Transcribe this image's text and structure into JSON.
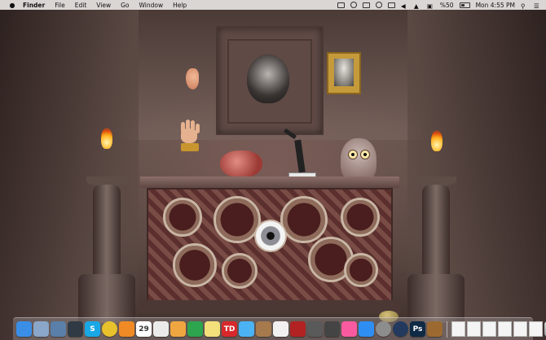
{
  "menubar": {
    "app_name": "Finder",
    "menus": [
      "File",
      "Edit",
      "View",
      "Go",
      "Window",
      "Help"
    ],
    "battery": "%50",
    "clock": "Mon 4:55 PM"
  },
  "dock": {
    "calendar_day": "29",
    "items": [
      {
        "name": "finder",
        "glyph": "",
        "color": "#3a8ee6"
      },
      {
        "name": "launchpad",
        "glyph": "",
        "color": "#8aa6c8"
      },
      {
        "name": "preview",
        "glyph": "",
        "color": "#5a7fa8"
      },
      {
        "name": "activity-monitor",
        "glyph": "",
        "color": "#2f3a44"
      },
      {
        "name": "skype",
        "glyph": "S",
        "color": "#1aa7e6"
      },
      {
        "name": "chrome",
        "glyph": "",
        "color": "#e8c22c"
      },
      {
        "name": "vlc",
        "glyph": "",
        "color": "#f08a24"
      },
      {
        "name": "calendar",
        "glyph": "",
        "color": "#ffffff"
      },
      {
        "name": "text-edit",
        "glyph": "",
        "color": "#eaeaea"
      },
      {
        "name": "pages",
        "glyph": "",
        "color": "#f0a640"
      },
      {
        "name": "evernote",
        "glyph": "",
        "color": "#2da44e"
      },
      {
        "name": "notes",
        "glyph": "",
        "color": "#f4e07a"
      },
      {
        "name": "todoist",
        "glyph": "TD",
        "color": "#d8282c"
      },
      {
        "name": "messages",
        "glyph": "",
        "color": "#4bb3f3"
      },
      {
        "name": "contacts",
        "glyph": "",
        "color": "#a67a4c"
      },
      {
        "name": "photos",
        "glyph": "",
        "color": "#f1f1f1"
      },
      {
        "name": "photo-booth",
        "glyph": "",
        "color": "#b22222"
      },
      {
        "name": "screenshot",
        "glyph": "",
        "color": "#5a5a5a"
      },
      {
        "name": "calculator",
        "glyph": "",
        "color": "#444444"
      },
      {
        "name": "itunes",
        "glyph": "",
        "color": "#fa5aa0"
      },
      {
        "name": "app-store",
        "glyph": "",
        "color": "#2f8ef2"
      },
      {
        "name": "system-preferences",
        "glyph": "",
        "color": "#8d8d8d"
      },
      {
        "name": "steam",
        "glyph": "",
        "color": "#233a5e"
      },
      {
        "name": "photoshop",
        "glyph": "Ps",
        "color": "#0f2a45"
      },
      {
        "name": "disk-utility",
        "glyph": "",
        "color": "#9c6a30"
      }
    ],
    "documents": [
      "doc-1",
      "doc-2",
      "doc-3",
      "doc-4",
      "doc-5",
      "doc-6"
    ]
  },
  "colors": {
    "menubar_bg": "#e8e6e4",
    "dock_bg": "#968c8c"
  }
}
